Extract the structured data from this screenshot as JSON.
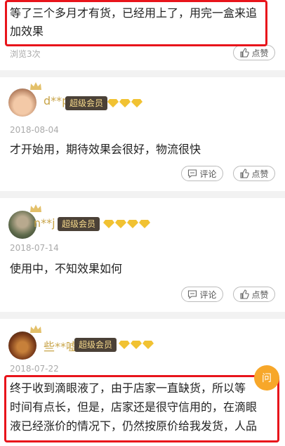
{
  "review0": {
    "line1": "等了三个多月才有货，已经用上了，用完一盒来追",
    "line2": "加效果",
    "views": "浏览3次",
    "like": "点赞"
  },
  "review1": {
    "user": "d**p",
    "badge": "超级会员",
    "date": "2018-08-04",
    "text": "才开始用，期待效果会很好，物流很快",
    "comment": "评论",
    "like": "点赞"
  },
  "review2": {
    "user": "n**j",
    "badge": "超级会员",
    "date": "2018-07-14",
    "text": "使用中，不知效果如何",
    "comment": "评论",
    "like": "点赞"
  },
  "review3": {
    "user": "些**嘘",
    "badge": "超级会员",
    "date": "2018-07-22",
    "line1": "终于收到滴眼液了，由于店家一直缺货，所以等",
    "line2": "时间有点长，但是，店家还是很守信用的，在滴眼",
    "line3": "液已经涨价的情况下，仍然按原价给我发货，人品"
  },
  "ask_label": "问",
  "colors": {
    "highlight": "#e8141b",
    "gold": "#c8a448",
    "badge_bg": "#4b4137"
  }
}
